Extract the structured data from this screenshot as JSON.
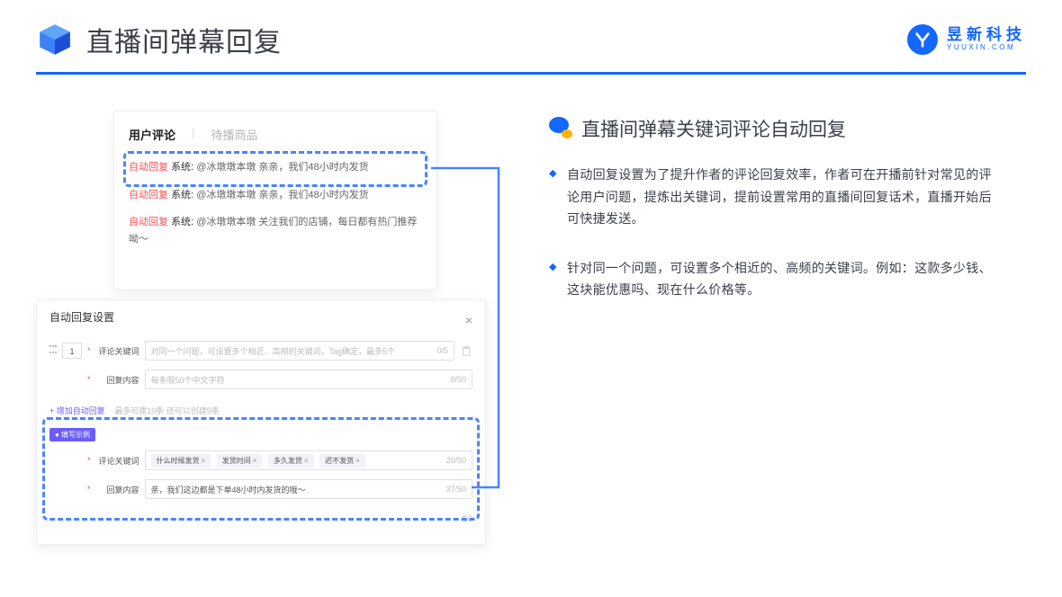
{
  "header": {
    "title": "直播间弹幕回复",
    "brand_cn": "昱新科技",
    "brand_en": "YUUXIN.COM"
  },
  "comments_panel": {
    "tab_active": "用户评论",
    "tab_inactive": "待播商品",
    "items": [
      {
        "tag": "自动回复",
        "system": "系统:",
        "text": "@冰墩墩本墩 亲亲，我们48小时内发货"
      },
      {
        "tag": "自动回复",
        "system": "系统:",
        "text": "@冰墩墩本墩 亲亲，我们48小时内发货"
      },
      {
        "tag": "自动回复",
        "system": "系统:",
        "text": "@冰墩墩本墩 关注我们的店铺，每日都有热门推荐呦～"
      }
    ]
  },
  "settings_modal": {
    "title": "自动回复设置",
    "close_x": "×",
    "order": "1",
    "keyword_label": "评论关键词",
    "keyword_placeholder": "对同一个问题，可设置多个相近、高频的关键词，Tag确定，最多5个",
    "keyword_counter": "0/5",
    "content_label": "回复内容",
    "content_placeholder": "每条限50个中文字符",
    "content_counter": "0/50",
    "add_link": "+ 增加自动回复",
    "add_hint": "最多可建10条 还可以创建9条",
    "example_badge": "● 填写示例",
    "example_keyword_label": "评论关键词",
    "example_tags": [
      "什么时候发货",
      "发货时间",
      "多久发货",
      "迟不发货"
    ],
    "example_kw_counter": "20/50",
    "example_content_label": "回复内容",
    "example_content_value": "亲，我们这边都是下单48小时内发货的哦～",
    "example_content_counter": "37/50",
    "footer_counter": "/50"
  },
  "right": {
    "section_title": "直播间弹幕关键词评论自动回复",
    "bullets": [
      "自动回复设置为了提升作者的评论回复效率，作者可在开播前针对常见的评论用户问题，提炼出关键词，提前设置常用的直播间回复话术，直播开始后可快捷发送。",
      "针对同一个问题，可设置多个相近的、高频的关键词。例如：这款多少钱、这块能优惠吗、现在什么价格等。"
    ]
  }
}
